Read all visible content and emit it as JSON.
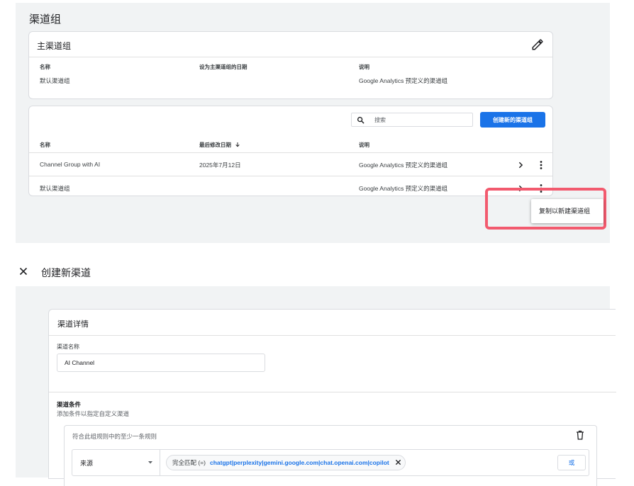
{
  "top": {
    "page_title": "渠道组",
    "primary": {
      "title": "主渠道组",
      "headers": [
        "名称",
        "设为主渠道组的日期",
        "说明"
      ],
      "row": {
        "name": "默认渠道组",
        "date": "",
        "desc": "Google Analytics 预定义的渠道组"
      },
      "edit_icon": "pencil-icon"
    },
    "list": {
      "search_placeholder": "搜索",
      "create_button": "创建新的渠道组",
      "headers": {
        "name": "名称",
        "modified": "最后修改日期",
        "desc": "说明"
      },
      "rows": [
        {
          "name": "Channel Group with AI",
          "modified": "2025年7月12日",
          "desc": "Google Analytics 预定义的渠道组"
        },
        {
          "name": "默认渠道组",
          "modified": "",
          "desc": "Google Analytics 预定义的渠道组"
        }
      ]
    },
    "menu": {
      "item": "复制以新建渠道组"
    },
    "highlight_color": "#f25a6e"
  },
  "bottom": {
    "title": "创建新渠道",
    "details_title": "渠道详情",
    "name_label": "渠道名称",
    "name_value": "AI Channel",
    "conditions_title": "渠道条件",
    "conditions_sub": "添加条件以指定自定义渠道",
    "rule_label": "符合此组规则中的至少一条规则",
    "dimension": "来源",
    "chip_op": "完全匹配 (=)",
    "chip_values": "chatgpt|perplexity|gemini.google.com|chat.openai.com|copilot",
    "or_button": "或"
  },
  "colors": {
    "accent": "#1a73e8",
    "panel_bg": "#f1f3f4"
  }
}
